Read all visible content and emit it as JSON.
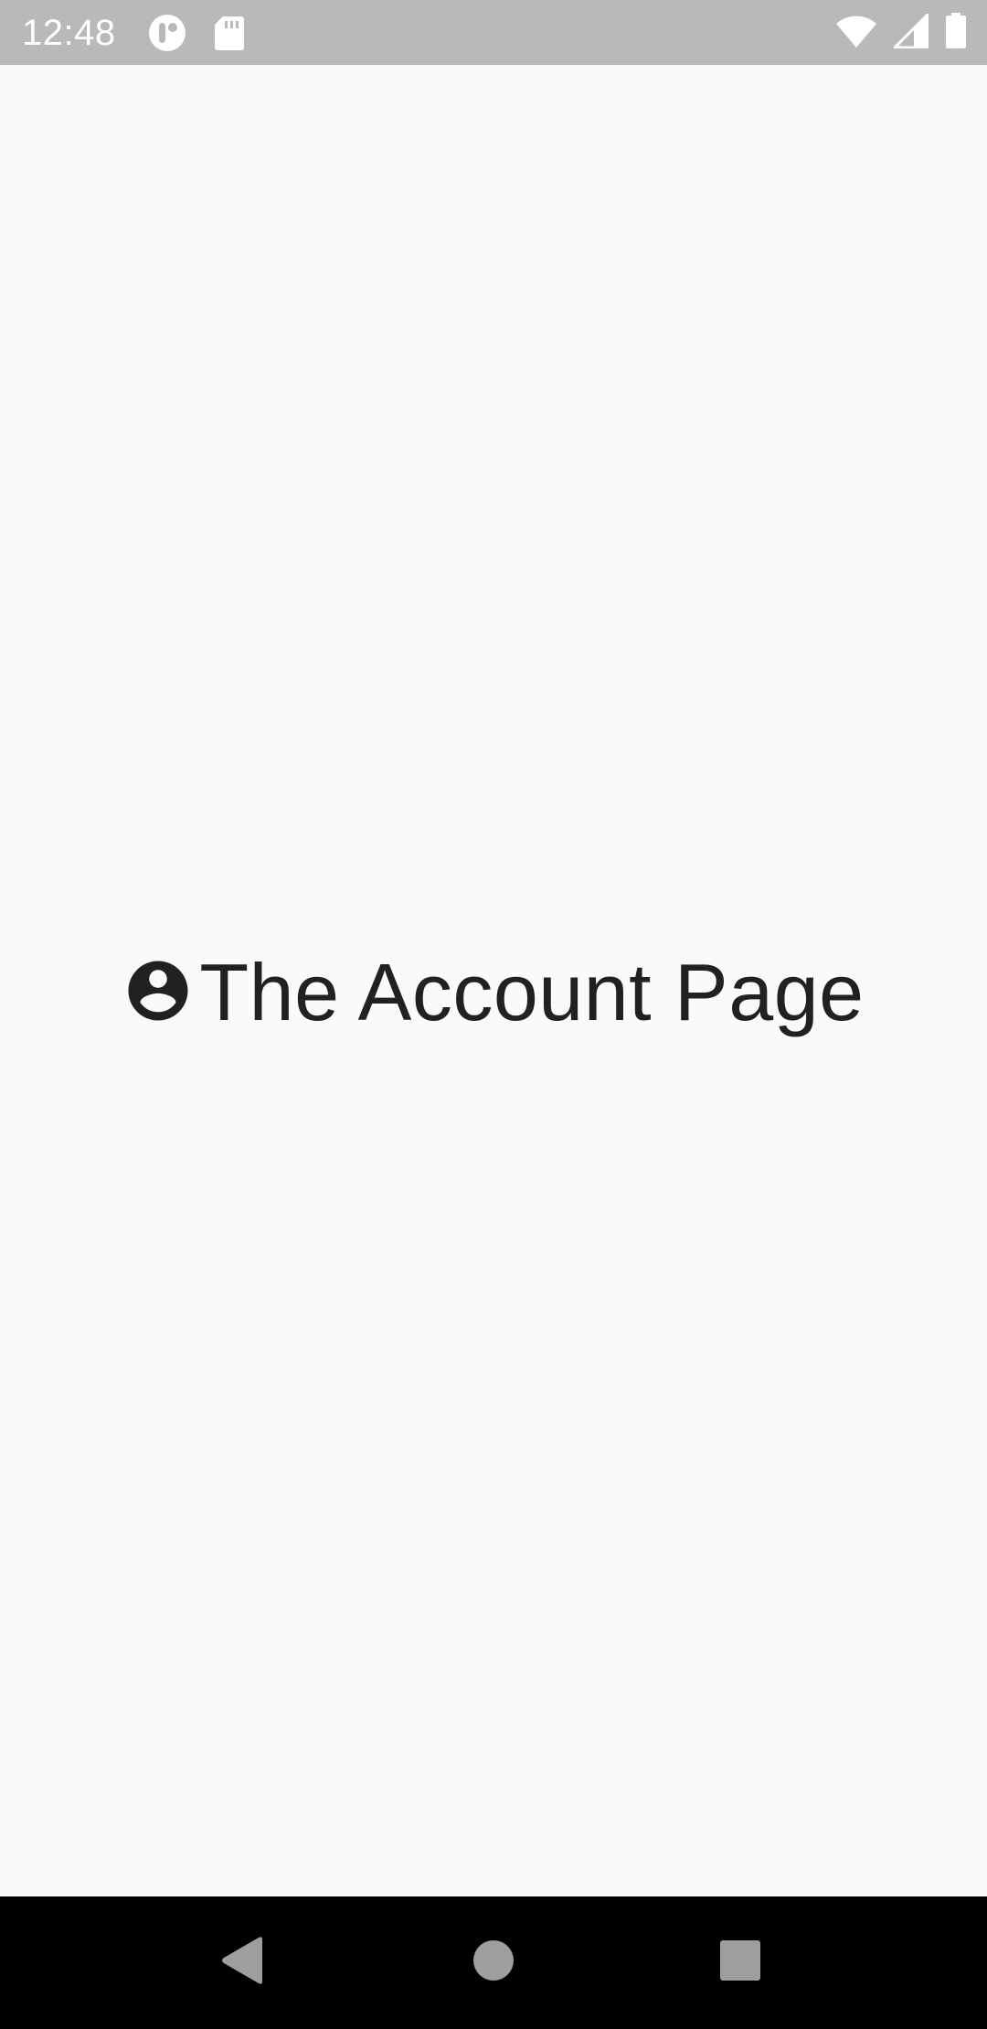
{
  "status_bar": {
    "time": "12:48",
    "icons_left": [
      "app-notification-icon",
      "sd-card-icon"
    ],
    "icons_right": [
      "wifi-icon",
      "cellular-signal-icon",
      "battery-icon"
    ],
    "background_color": "#b9b9b9"
  },
  "main": {
    "title": "The Account Page",
    "icon": "account-circle-icon",
    "text_color": "#212121",
    "background_color": "#fafafa"
  },
  "nav_bar": {
    "buttons": [
      "back",
      "home",
      "recents"
    ],
    "background_color": "#000000"
  }
}
